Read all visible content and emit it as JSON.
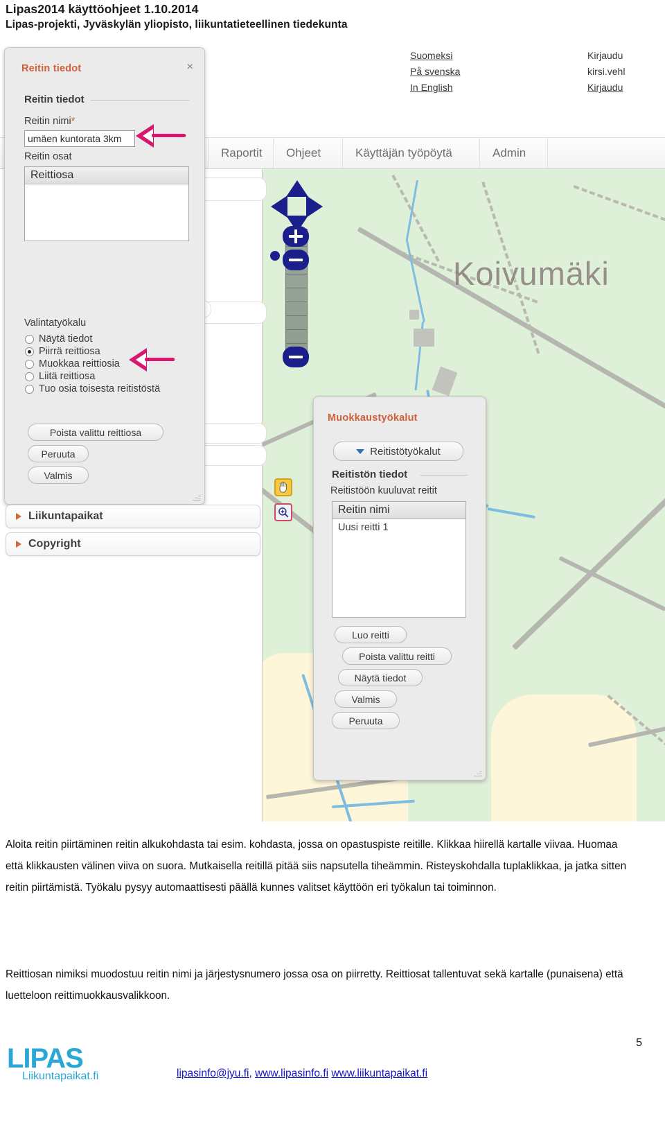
{
  "document": {
    "header_line1": "Lipas2014 käyttöohjeet 1.10.2014",
    "header_line2": "Lipas-projekti, Jyväskylän yliopisto, liikuntatieteellinen tiedekunta",
    "page_number": "5"
  },
  "app": {
    "languages": [
      {
        "label": "Suomeksi"
      },
      {
        "label": "På svenska"
      },
      {
        "label": "In English"
      }
    ],
    "login": {
      "line1": "Kirjaudu",
      "line2": "kirsi.vehl",
      "line3": "Kirjaudu"
    },
    "nav": [
      {
        "label": "Raportit"
      },
      {
        "label": "Ohjeet"
      },
      {
        "label": "Käyttäjän työpöytä"
      },
      {
        "label": "Admin"
      }
    ]
  },
  "map": {
    "place_label": "Koivumäki",
    "tools": [
      {
        "name": "pan-hand-tool"
      },
      {
        "name": "zoom-box-tool"
      }
    ],
    "controls": {
      "pan": "pan-control",
      "zoom_in": "+",
      "zoom_out": "−"
    }
  },
  "route_dialog": {
    "title": "Reitin tiedot",
    "close": "×",
    "legend": "Reitin tiedot",
    "name_label": "Reitin nimi",
    "name_required_mark": "*",
    "name_value": "umäen kuntorata 3km",
    "parts_label": "Reitin osat",
    "parts_list_header": "Reittiosa",
    "parts_rows": [],
    "tool_group_label": "Valintatyökalu",
    "tool_options": [
      {
        "label": "Näytä tiedot",
        "selected": false
      },
      {
        "label": "Piirrä reittiosa",
        "selected": true
      },
      {
        "label": "Muokkaa reittiosia",
        "selected": false
      },
      {
        "label": "Liitä reittiosa",
        "selected": false
      },
      {
        "label": "Tuo osia toisesta reitistöstä",
        "selected": false
      }
    ],
    "buttons": [
      {
        "label": "Poista valittu reittiosa"
      },
      {
        "label": "Peruuta"
      },
      {
        "label": "Valmis"
      }
    ]
  },
  "edit_tools_dialog": {
    "title": "Muokkaustyökalut",
    "dropdown_label": "Reitistötyökalut",
    "legend": "Reitistön tiedot",
    "list_label": "Reitistöön kuuluvat reitit",
    "list_header": "Reitin nimi",
    "list_rows": [
      {
        "label": "Uusi reitti 1"
      }
    ],
    "buttons": [
      {
        "label": "Luo reitti"
      },
      {
        "label": "Poista valittu reitti"
      },
      {
        "label": "Näytä tiedot"
      },
      {
        "label": "Valmis"
      },
      {
        "label": "Peruuta"
      }
    ]
  },
  "sidebar": {
    "accordions": [
      {
        "label": "Liikuntapaikat"
      },
      {
        "label": "Copyright"
      }
    ]
  },
  "annotations": [
    {
      "name": "arrow-to-route-name"
    },
    {
      "name": "arrow-to-draw-route-part"
    }
  ],
  "body": {
    "paragraph1": "Aloita reitin piirtäminen reitin alkukohdasta tai esim. kohdasta, jossa on opastuspiste reitille. Klikkaa hiirellä kartalle viivaa. Huomaa että klikkausten välinen viiva on suora. Mutkaisella reitillä pitää siis napsutella tiheämmin. Risteyskohdalla tuplaklikkaa, ja jatka sitten reitin piirtämistä. Työkalu pysyy automaattisesti päällä kunnes valitset käyttöön eri työkalun tai toiminnon.",
    "paragraph2": "Reittiosan nimiksi muodostuu reitin nimi ja järjestysnumero jossa osa on piirretty. Reittiosat tallentuvat sekä kartalle (punaisena) että luetteloon reittimuokkausvalikkoon."
  },
  "footer": {
    "logo_mark": "LIPAS",
    "logo_sub": "Liikuntapaikat.fi",
    "email": "lipasinfo@jyu.fi",
    "separator": ", ",
    "site1": "www.lipasinfo.fi",
    "space": " ",
    "site2": "www.liikuntapaikat.fi"
  },
  "colors": {
    "accent_orange": "#d1603a",
    "annotation_pink": "#d6186e",
    "link_blue": "#1414c8",
    "logo_blue": "#2ba7d5",
    "map_green": "#dff0d9",
    "map_field": "#fdf6d8"
  }
}
